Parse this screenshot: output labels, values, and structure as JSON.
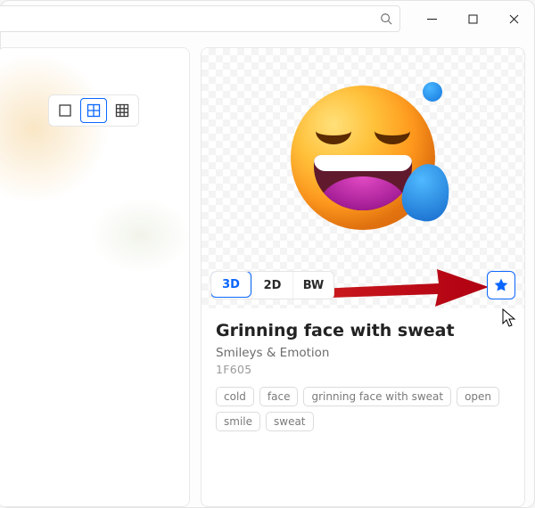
{
  "window": {
    "minimize": "min",
    "maximize": "max",
    "close": "close"
  },
  "search": {
    "placeholder": ""
  },
  "size_options": {
    "single": "single",
    "four": "four",
    "nine": "nine",
    "active": "four"
  },
  "detail": {
    "variants": {
      "three_d": "3D",
      "two_d": "2D",
      "bw": "BW"
    },
    "active_variant": "3D",
    "title": "Grinning face with sweat",
    "category": "Smileys & Emotion",
    "codepoint": "1F605",
    "tags": [
      "cold",
      "face",
      "grinning face with sweat",
      "open",
      "smile",
      "sweat"
    ]
  }
}
